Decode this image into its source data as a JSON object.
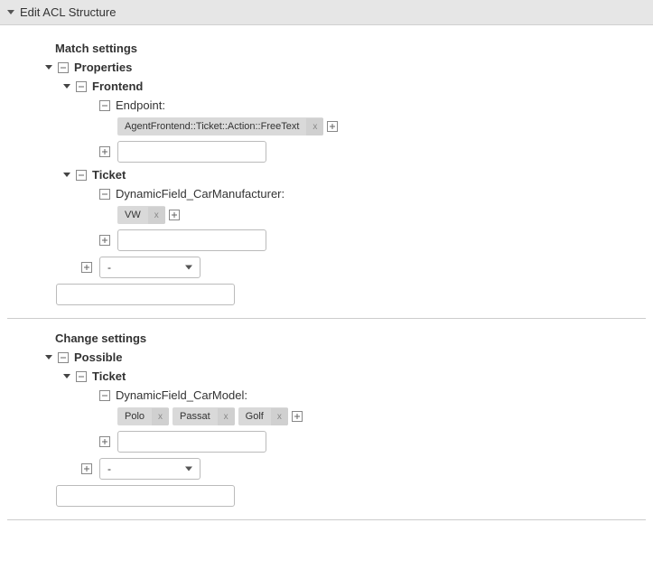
{
  "header": {
    "title": "Edit ACL Structure"
  },
  "match": {
    "title": "Match settings",
    "properties_label": "Properties",
    "frontend": {
      "label": "Frontend",
      "endpoint_label": "Endpoint:",
      "tags": {
        "agent_frontend": "AgentFrontend::Ticket::Action::FreeText"
      },
      "tag_x": "x",
      "input_value": ""
    },
    "ticket": {
      "label": "Ticket",
      "field_label": "DynamicField_CarManufacturer:",
      "tags": {
        "vw": "VW"
      },
      "tag_x": "x",
      "input_value": "",
      "select_value": "-"
    },
    "bottom_input_value": ""
  },
  "change": {
    "title": "Change settings",
    "possible_label": "Possible",
    "ticket": {
      "label": "Ticket",
      "field_label": "DynamicField_CarModel:",
      "tags": {
        "polo": "Polo",
        "passat": "Passat",
        "golf": "Golf"
      },
      "tag_x": "x",
      "input_value": "",
      "select_value": "-"
    },
    "bottom_input_value": ""
  }
}
